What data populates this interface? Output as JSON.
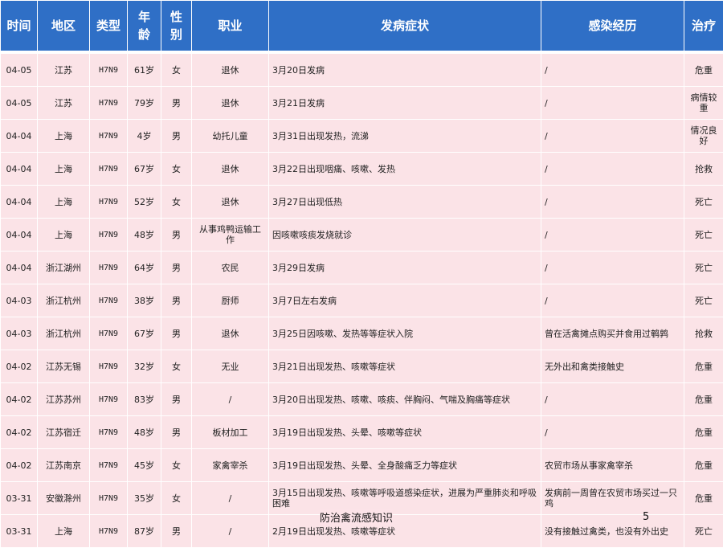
{
  "headers": {
    "time": "时间",
    "region": "地区",
    "type": "类型",
    "age_1": "年",
    "age_2": "龄",
    "sex_1": "性",
    "sex_2": "别",
    "job": "职业",
    "symptom": "发病症状",
    "infection": "感染经历",
    "treatment": "治疗"
  },
  "rows": [
    {
      "time": "04-05",
      "region": "江苏",
      "type": "H7N9",
      "age": "61岁",
      "sex": "女",
      "job": "退休",
      "symptom": "3月20日发病",
      "infection": "/",
      "treatment": "危重"
    },
    {
      "time": "04-05",
      "region": "江苏",
      "type": "H7N9",
      "age": "79岁",
      "sex": "男",
      "job": "退休",
      "symptom": "3月21日发病",
      "infection": "/",
      "treatment": "病情较重"
    },
    {
      "time": "04-04",
      "region": "上海",
      "type": "H7N9",
      "age": "4岁",
      "sex": "男",
      "job": "幼托儿童",
      "symptom": "3月31日出现发热，流涕",
      "infection": "/",
      "treatment": "情况良好"
    },
    {
      "time": "04-04",
      "region": "上海",
      "type": "H7N9",
      "age": "67岁",
      "sex": "女",
      "job": "退休",
      "symptom": "3月22日出现咽痛、咳嗽、发热",
      "infection": "/",
      "treatment": "抢救"
    },
    {
      "time": "04-04",
      "region": "上海",
      "type": "H7N9",
      "age": "52岁",
      "sex": "女",
      "job": "退休",
      "symptom": "3月27日出现低热",
      "infection": "/",
      "treatment": "死亡"
    },
    {
      "time": "04-04",
      "region": "上海",
      "type": "H7N9",
      "age": "48岁",
      "sex": "男",
      "job": "从事鸡鸭运输工作",
      "symptom": "因咳嗽咳痰发烧就诊",
      "infection": "/",
      "treatment": "死亡"
    },
    {
      "time": "04-04",
      "region": "浙江湖州",
      "type": "H7N9",
      "age": "64岁",
      "sex": "男",
      "job": "农民",
      "symptom": "3月29日发病",
      "infection": "/",
      "treatment": "死亡"
    },
    {
      "time": "04-03",
      "region": "浙江杭州",
      "type": "H7N9",
      "age": "38岁",
      "sex": "男",
      "job": "厨师",
      "symptom": "3月7日左右发病",
      "infection": "/",
      "treatment": "死亡"
    },
    {
      "time": "04-03",
      "region": "浙江杭州",
      "type": "H7N9",
      "age": "67岁",
      "sex": "男",
      "job": "退休",
      "symptom": "3月25日因咳嗽、发热等等症状入院",
      "infection": "曾在活禽摊点购买并食用过鹌鹑",
      "treatment": "抢救"
    },
    {
      "time": "04-02",
      "region": "江苏无锡",
      "type": "H7N9",
      "age": "32岁",
      "sex": "女",
      "job": "无业",
      "symptom": "3月21日出现发热、咳嗽等症状",
      "infection": "无外出和禽类接触史",
      "treatment": "危重"
    },
    {
      "time": "04-02",
      "region": "江苏苏州",
      "type": "H7N9",
      "age": "83岁",
      "sex": "男",
      "job": "/",
      "symptom": "3月20日出现发热、咳嗽、咳痰、伴胸闷、气喘及胸痛等症状",
      "infection": "/",
      "treatment": "危重"
    },
    {
      "time": "04-02",
      "region": "江苏宿迁",
      "type": "H7N9",
      "age": "48岁",
      "sex": "男",
      "job": "板材加工",
      "symptom": "3月19日出现发热、头晕、咳嗽等症状",
      "infection": "/",
      "treatment": "危重"
    },
    {
      "time": "04-02",
      "region": "江苏南京",
      "type": "H7N9",
      "age": "45岁",
      "sex": "女",
      "job": "家禽宰杀",
      "symptom": "3月19日出现发热、头晕、全身酸痛乏力等症状",
      "infection": "农贸市场从事家禽宰杀",
      "treatment": "危重"
    },
    {
      "time": "03-31",
      "region": "安徽滁州",
      "type": "H7N9",
      "age": "35岁",
      "sex": "女",
      "job": "/",
      "symptom": "3月15日出现发热、咳嗽等呼吸道感染症状，进展为严重肺炎和呼吸困难",
      "infection": "发病前一周曾在农贸市场买过一只鸡",
      "treatment": "危重"
    },
    {
      "time": "03-31",
      "region": "上海",
      "type": "H7N9",
      "age": "87岁",
      "sex": "男",
      "job": "/",
      "symptom": "2月19日出现发热、咳嗽等症状",
      "infection": "没有接触过禽类，也没有外出史",
      "treatment": "死亡"
    }
  ],
  "footer": {
    "title": "防治禽流感知识",
    "page_number": "5"
  }
}
